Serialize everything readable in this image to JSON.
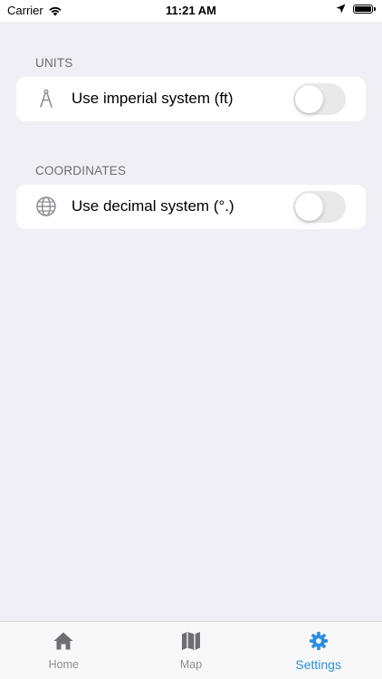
{
  "status_bar": {
    "carrier": "Carrier",
    "time": "11:21 AM",
    "battery_level": 1.0
  },
  "sections": [
    {
      "header": "UNITS",
      "row": {
        "icon": "compass-drawing-icon",
        "label": "Use imperial system (ft)",
        "toggle_on": false
      }
    },
    {
      "header": "COORDINATES",
      "row": {
        "icon": "globe-icon",
        "label": "Use decimal system (°.)",
        "toggle_on": false
      }
    }
  ],
  "tab_bar": {
    "tabs": [
      {
        "label": "Home",
        "icon": "home-icon",
        "active": false
      },
      {
        "label": "Map",
        "icon": "map-icon",
        "active": false
      },
      {
        "label": "Settings",
        "icon": "gear-icon",
        "active": true
      }
    ]
  },
  "colors": {
    "background": "#f0eff5",
    "card": "#ffffff",
    "accent": "#2d8ee0",
    "section_header": "#6d6d72",
    "tab_inactive": "#8e8e93",
    "toggle_off": "#e9e9ea"
  }
}
